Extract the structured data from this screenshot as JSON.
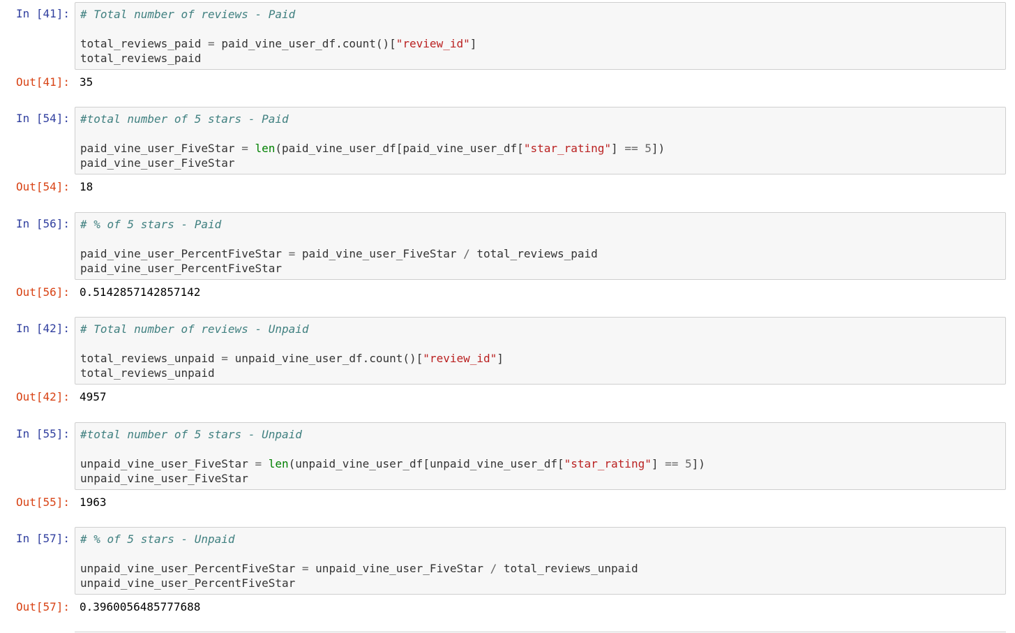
{
  "cells": [
    {
      "in_prompt": "In [41]:",
      "out_prompt": "Out[41]:",
      "comment": "# Total number of reviews - Paid",
      "line2": {
        "var": "total_reviews_paid",
        "eq": "=",
        "expr": "paid_vine_user_df.count()[",
        "str": "\"review_id\"",
        "close": "]"
      },
      "line3": "total_reviews_paid",
      "output": "35"
    },
    {
      "in_prompt": "In [54]:",
      "out_prompt": "Out[54]:",
      "comment": "#total number of 5 stars - Paid",
      "line2": {
        "var": "paid_vine_user_FiveStar",
        "eq": "=",
        "builtin": "len",
        "expr": "(paid_vine_user_df[paid_vine_user_df[",
        "str": "\"star_rating\"",
        "mid": "] ",
        "cmp": "==",
        "num": "5",
        "close": "])"
      },
      "line3": "paid_vine_user_FiveStar",
      "output": "18"
    },
    {
      "in_prompt": "In [56]:",
      "out_prompt": "Out[56]:",
      "comment": "# % of 5 stars - Paid",
      "line2": {
        "var": "paid_vine_user_PercentFiveStar",
        "eq": "=",
        "left": "paid_vine_user_FiveStar",
        "div": "/",
        "right": "total_reviews_paid"
      },
      "line3": "paid_vine_user_PercentFiveStar",
      "output": "0.5142857142857142"
    },
    {
      "in_prompt": "In [42]:",
      "out_prompt": "Out[42]:",
      "comment": "# Total number of reviews - Unpaid",
      "line2": {
        "var": "total_reviews_unpaid",
        "eq": "=",
        "expr": "unpaid_vine_user_df.count()[",
        "str": "\"review_id\"",
        "close": "]"
      },
      "line3": "total_reviews_unpaid",
      "output": "4957"
    },
    {
      "in_prompt": "In [55]:",
      "out_prompt": "Out[55]:",
      "comment": "#total number of 5 stars - Unpaid",
      "line2": {
        "var": "unpaid_vine_user_FiveStar",
        "eq": "=",
        "builtin": "len",
        "expr": "(unpaid_vine_user_df[unpaid_vine_user_df[",
        "str": "\"star_rating\"",
        "mid": "] ",
        "cmp": "==",
        "num": "5",
        "close": "])"
      },
      "line3": "unpaid_vine_user_FiveStar",
      "output": "1963"
    },
    {
      "in_prompt": "In [57]:",
      "out_prompt": "Out[57]:",
      "comment": "# % of 5 stars - Unpaid",
      "line2": {
        "var": "unpaid_vine_user_PercentFiveStar",
        "eq": "=",
        "left": "unpaid_vine_user_FiveStar",
        "div": "/",
        "right": "total_reviews_unpaid"
      },
      "line3": "unpaid_vine_user_PercentFiveStar",
      "output": "0.3960056485777688"
    }
  ]
}
